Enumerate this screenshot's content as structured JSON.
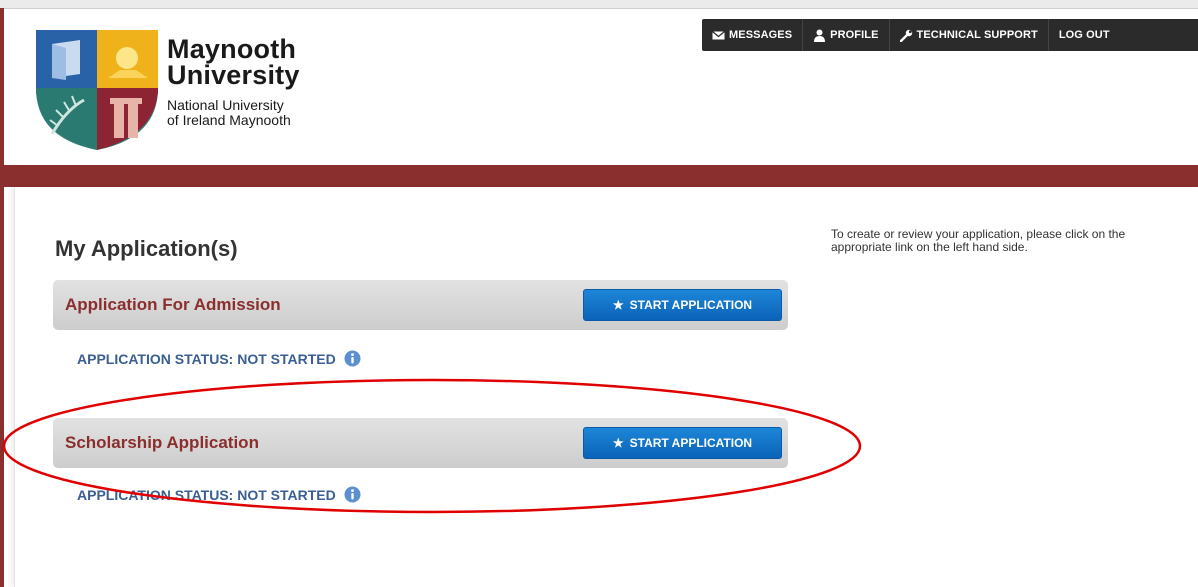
{
  "header": {
    "logo": {
      "name_line1": "Maynooth",
      "name_line2": "University",
      "subtitle_line1": "National University",
      "subtitle_line2": "of Ireland Maynooth"
    },
    "nav": [
      {
        "label": "MESSAGES",
        "icon": "envelope-icon"
      },
      {
        "label": "PROFILE",
        "icon": "user-icon"
      },
      {
        "label": "TECHNICAL SUPPORT",
        "icon": "wrench-icon"
      },
      {
        "label": "LOG OUT",
        "icon": ""
      }
    ]
  },
  "main": {
    "title": "My Application(s)",
    "help_text": "To create or review your application, please click on the appropriate link on the left hand side.",
    "applications": [
      {
        "name": "Application For Admission",
        "button_label": "START APPLICATION",
        "status": "APPLICATION STATUS: NOT STARTED"
      },
      {
        "name": "Scholarship Application",
        "button_label": "START APPLICATION",
        "status": "APPLICATION STATUS: NOT STARTED"
      }
    ]
  },
  "colors": {
    "brand_maroon": "#8a2e2e",
    "button_blue": "#0b63b8",
    "status_blue": "#3a5f94",
    "nav_dark": "#2b2b2b",
    "annotation_red": "#e00000"
  }
}
